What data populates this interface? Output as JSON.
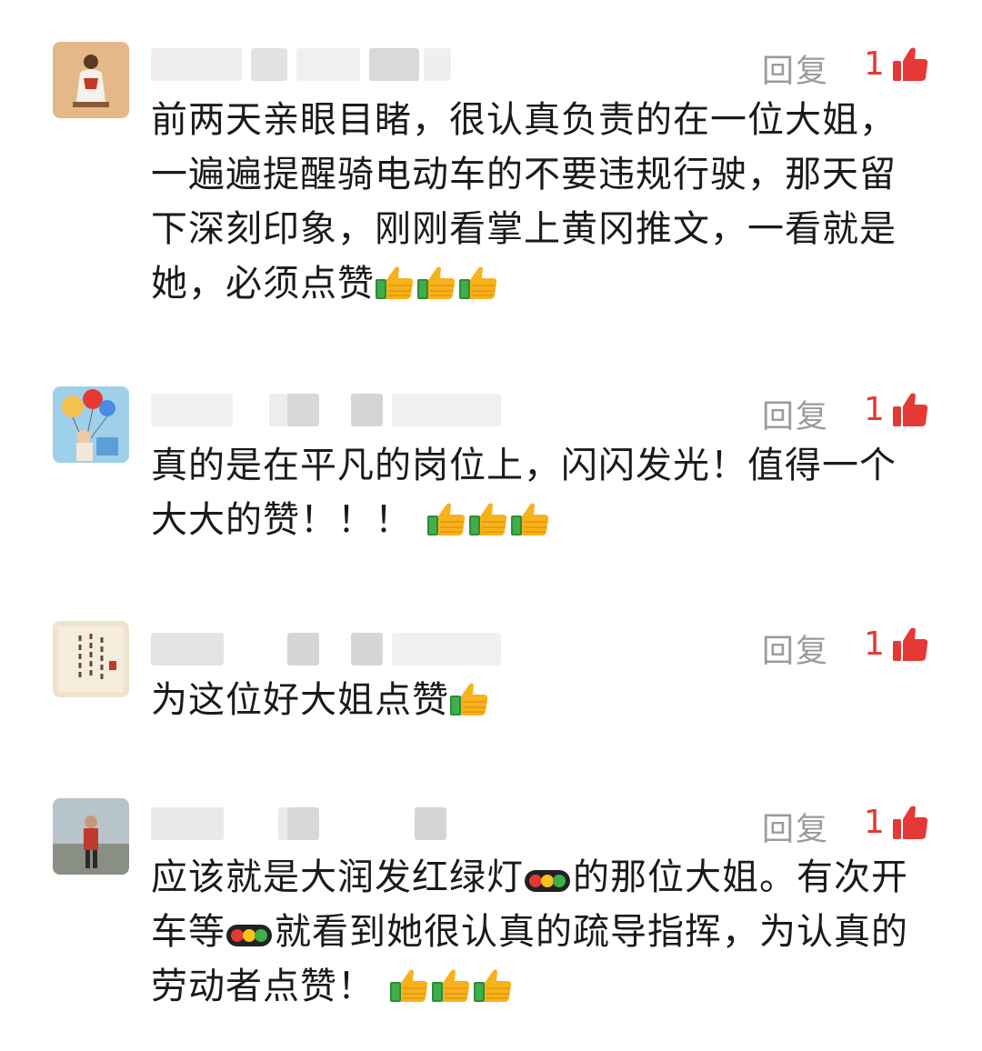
{
  "comments": [
    {
      "reply_label": "回复",
      "like_count": "1",
      "text": "前两天亲眼目睹，很认真负责的在一位大姐，一遍遍提醒骑电动车的不要违规行驶，那天留下深刻印象，刚刚看掌上黄冈推文，一看就是她，必须点赞",
      "emoji": [
        "thumbs-up-icon",
        "thumbs-up-icon",
        "thumbs-up-icon"
      ]
    },
    {
      "reply_label": "回复",
      "like_count": "1",
      "text": "真的是在平凡的岗位上，闪闪发光！值得一个大大的赞！！！",
      "emoji": [
        "thumbs-up-icon",
        "thumbs-up-icon",
        "thumbs-up-icon"
      ]
    },
    {
      "reply_label": "回复",
      "like_count": "1",
      "text": "为这位好大姐点赞",
      "emoji": [
        "thumbs-up-icon"
      ]
    },
    {
      "reply_label": "回复",
      "like_count": "1",
      "text_parts": [
        "应该就是大润发红绿灯",
        "的那位大姐。有次开车等",
        "就看到她很认真的疏导指挥，为认真的劳动者点赞！"
      ],
      "emoji": [
        "traffic-light-icon",
        "traffic-light-icon",
        "thumbs-up-icon",
        "thumbs-up-icon",
        "thumbs-up-icon"
      ]
    }
  ],
  "colors": {
    "like_red": "#e53935",
    "reply_gray": "#9b9b9b",
    "text": "#1a1a1a"
  }
}
